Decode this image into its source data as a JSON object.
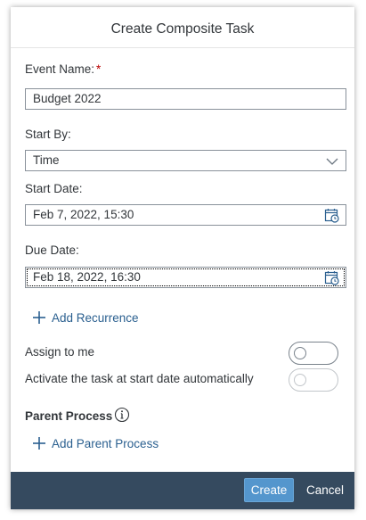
{
  "dialog": {
    "title": "Create Composite Task"
  },
  "form": {
    "event_name": {
      "label": "Event Name:",
      "required_marker": "*",
      "value": "Budget 2022"
    },
    "start_by": {
      "label": "Start By:",
      "value": "Time"
    },
    "start_date": {
      "label": "Start Date:",
      "value": "Feb 7, 2022, 15:30"
    },
    "due_date": {
      "label": "Due Date:",
      "value": "Feb 18, 2022, 16:30"
    },
    "add_recurrence_label": "Add Recurrence",
    "assign_to_me": {
      "label": "Assign to me",
      "state": "off"
    },
    "activate_auto": {
      "label": "Activate the task at start date automatically",
      "state": "off",
      "disabled": true
    },
    "parent_process": {
      "title": "Parent Process",
      "add_label": "Add Parent Process"
    }
  },
  "footer": {
    "create_label": "Create",
    "cancel_label": "Cancel"
  },
  "colors": {
    "footer_bg": "#354a5f",
    "primary_button": "#5496cd",
    "link": "#2a5f8f",
    "required": "#bb0000"
  },
  "icons": {
    "calendar": "calendar-icon",
    "dropdown": "chevron-down-icon",
    "add": "plus-icon",
    "info": "info-icon"
  }
}
